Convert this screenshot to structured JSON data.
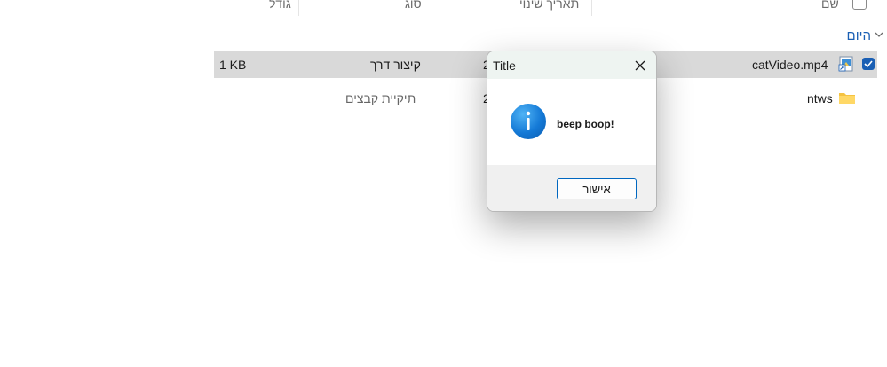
{
  "header": {
    "col_name": "שם",
    "col_date": "תאריך שינוי",
    "col_type": "סוג",
    "col_size": "גודל"
  },
  "group": {
    "label": "היום"
  },
  "files": [
    {
      "name": "catVideo.mp4",
      "date_fragment": "2",
      "type": "קיצור דרך",
      "size": "1 KB",
      "selected": true,
      "icon": "shortcut-video-icon"
    },
    {
      "name": "ntws",
      "date_fragment": "2",
      "type": "תיקיית קבצים",
      "size": "",
      "selected": false,
      "icon": "folder-icon"
    }
  ],
  "dialog": {
    "title": "Title",
    "message": "beep boop!",
    "ok_label": "אישור",
    "icon": "info-icon"
  },
  "colors": {
    "accent": "#0067c0",
    "selection": "#d9d9d9",
    "group_label": "#1a5fb4",
    "dialog_titlebar": "#eef4f1"
  }
}
